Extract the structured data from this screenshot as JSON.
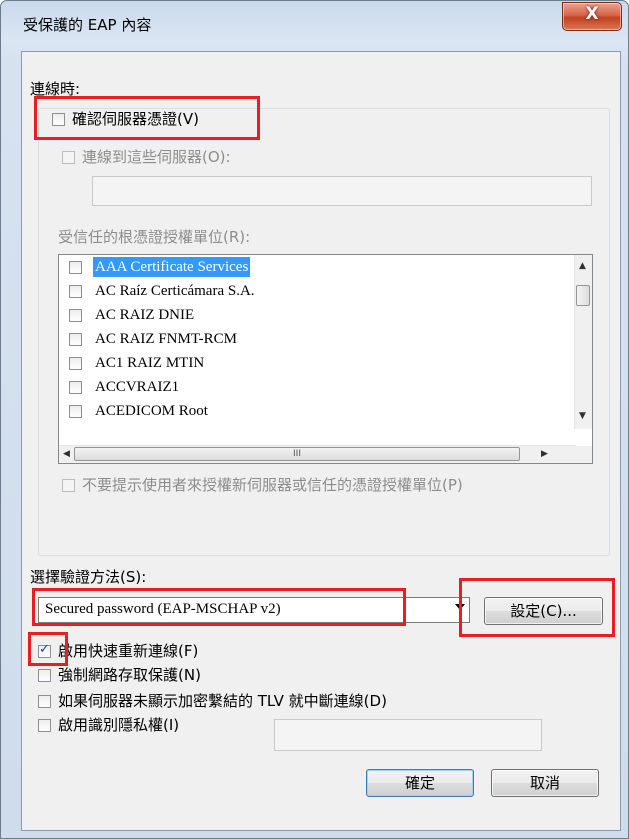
{
  "window": {
    "title": "受保護的 EAP 內容",
    "close_label": "X"
  },
  "connect": {
    "heading": "連線時:",
    "validate_cert_label": "確認伺服器憑證(V)",
    "validate_cert_checked": false,
    "connect_servers_label": "連線到這些伺服器(O):",
    "connect_servers_value": "",
    "trusted_ca_label": "受信任的根憑證授權單位(R):",
    "ca_list": [
      {
        "name": "AAA Certificate Services",
        "checked": false,
        "selected": true
      },
      {
        "name": "AC Raíz Certicámara S.A.",
        "checked": false,
        "selected": false
      },
      {
        "name": "AC RAIZ DNIE",
        "checked": false,
        "selected": false
      },
      {
        "name": "AC RAIZ FNMT-RCM",
        "checked": false,
        "selected": false
      },
      {
        "name": "AC1 RAIZ MTIN",
        "checked": false,
        "selected": false
      },
      {
        "name": "ACCVRAIZ1",
        "checked": false,
        "selected": false
      },
      {
        "name": "ACEDICOM Root",
        "checked": false,
        "selected": false
      }
    ],
    "hscroll_grip": "III",
    "no_prompt_label": "不要提示使用者來授權新伺服器或信任的憑證授權單位(P)"
  },
  "auth": {
    "method_label": "選擇驗證方法(S):",
    "method_value": "Secured password (EAP-MSCHAP v2)",
    "configure_label": "設定(C)..."
  },
  "options": [
    {
      "label": "啟用快速重新連線(F)",
      "checked": true
    },
    {
      "label": "強制網路存取保護(N)",
      "checked": false
    },
    {
      "label": "如果伺服器未顯示加密繫結的 TLV 就中斷連線(D)",
      "checked": false
    },
    {
      "label": "啟用識別隱私權(I)",
      "checked": false
    }
  ],
  "privacy_value": "",
  "buttons": {
    "ok_label": "確定",
    "cancel_label": "取消"
  },
  "colors": {
    "highlight_box": "#ea1c24",
    "selection": "#3399ff"
  }
}
